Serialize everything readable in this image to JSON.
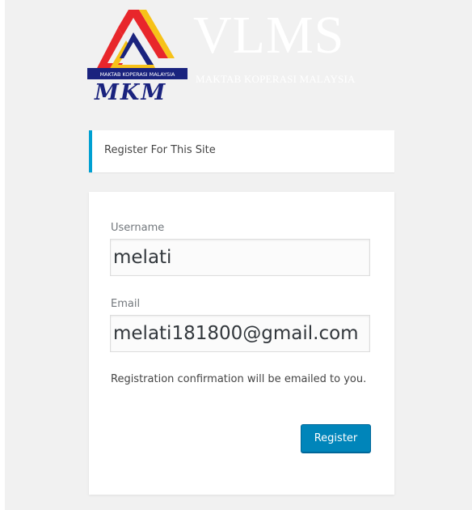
{
  "branding": {
    "title": "VLMS",
    "subtitle": "MAKTAB KOPERASI MALAYSIA",
    "logo_text": "MKM",
    "logo_banner": "MAKTAB KOPERASI MALAYSIA"
  },
  "notice": {
    "text": "Register For This Site"
  },
  "form": {
    "username_label": "Username",
    "username_value": "melati",
    "email_label": "Email",
    "email_value": "melati181800@gmail.com",
    "hint": "Registration confirmation will be emailed to you.",
    "submit_label": "Register"
  },
  "colors": {
    "accent": "#00a0d2",
    "button": "#0085ba",
    "page_background": "#f1f1f1"
  }
}
